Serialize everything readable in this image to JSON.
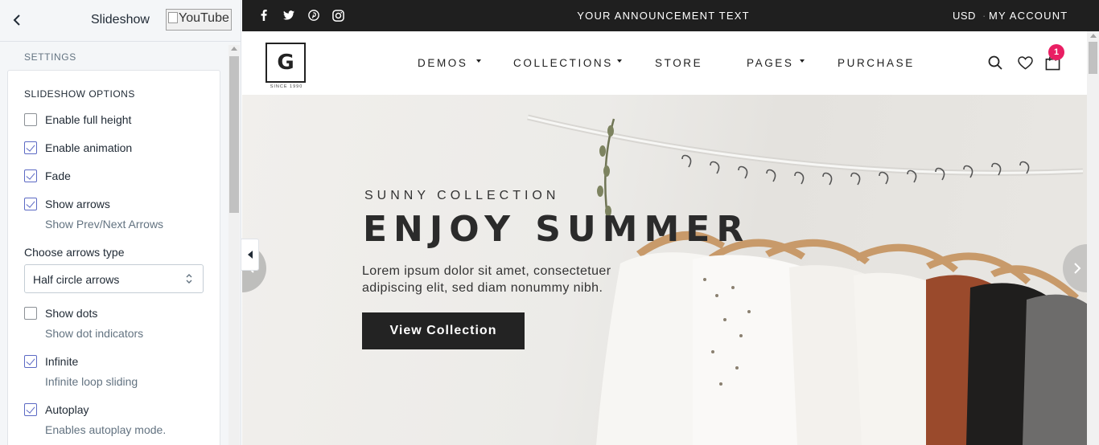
{
  "editor": {
    "title": "Slideshow",
    "youtube_alt": "YouTube",
    "settings_label": "SETTINGS",
    "section_title": "SLIDESHOW OPTIONS",
    "options": [
      {
        "label": "Enable full height",
        "checked": false
      },
      {
        "label": "Enable animation",
        "checked": true
      },
      {
        "label": "Fade",
        "checked": true
      },
      {
        "label": "Show arrows",
        "checked": true,
        "help": "Show Prev/Next Arrows"
      },
      {
        "label": "Show dots",
        "checked": false,
        "help": "Show dot indicators"
      },
      {
        "label": "Infinite",
        "checked": true,
        "help": "Infinite loop sliding"
      },
      {
        "label": "Autoplay",
        "checked": true,
        "help": "Enables autoplay mode."
      }
    ],
    "arrows_type": {
      "label": "Choose arrows type",
      "selected": "Half circle arrows"
    }
  },
  "store": {
    "topbar": {
      "social_icons": [
        "facebook-icon",
        "twitter-icon",
        "pinterest-icon",
        "instagram-icon"
      ],
      "announcement": "YOUR ANNOUNCEMENT TEXT",
      "currency": "USD",
      "account": "MY ACCOUNT"
    },
    "logo": {
      "letter": "G",
      "since": "SINCE 1990"
    },
    "nav": [
      {
        "label": "DEMOS",
        "dropdown": true
      },
      {
        "label": "COLLECTIONS",
        "dropdown": true
      },
      {
        "label": "STORE",
        "dropdown": false
      },
      {
        "label": "PAGES",
        "dropdown": true
      },
      {
        "label": "PURCHASE",
        "dropdown": false
      }
    ],
    "cart_count": "1",
    "hero": {
      "subtitle": "SUNNY COLLECTION",
      "title": "ENJOY SUMMER",
      "text": "Lorem ipsum dolor sit amet, consectetuer adipiscing elit, sed diam nonummy nibh.",
      "button": "View Collection"
    }
  },
  "colors": {
    "accent": "#5c6ac4",
    "topbar_bg": "#1f1f1f",
    "badge": "#e91e63",
    "hero_button": "#232323"
  }
}
